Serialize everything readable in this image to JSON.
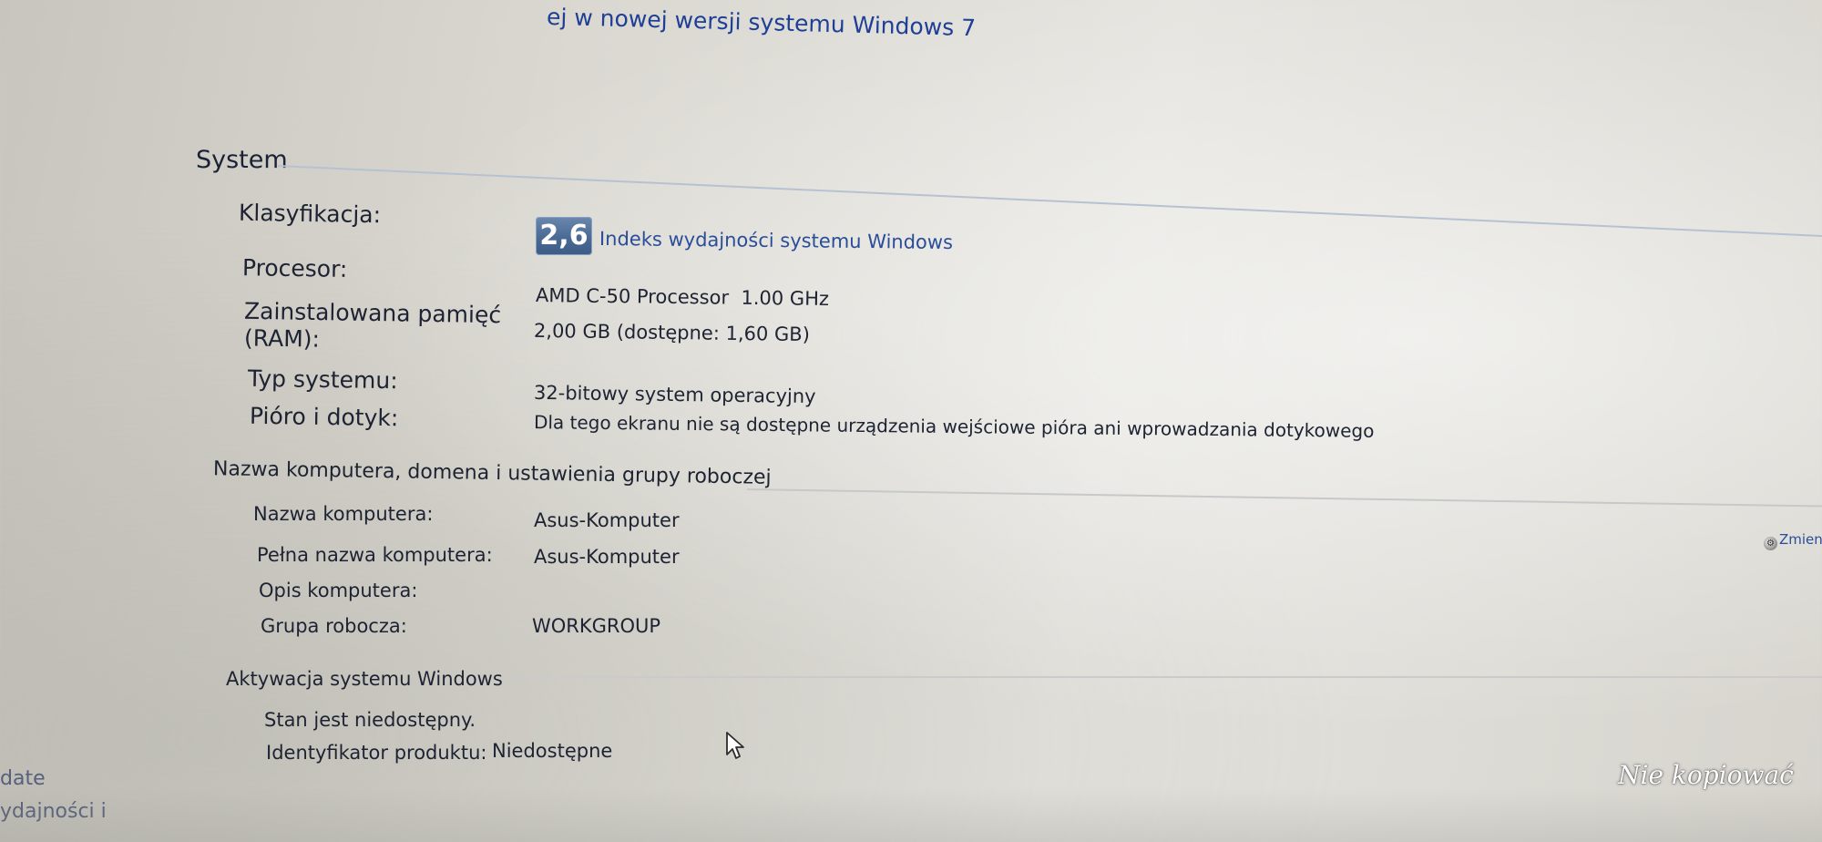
{
  "top_link": "ej w nowej wersji systemu Windows 7",
  "system": {
    "title": "System",
    "rating_label": "Klasyfikacja:",
    "rating_score": "2,6",
    "rating_link": "Indeks wydajności systemu Windows",
    "processor_label": "Procesor:",
    "processor_value": "AMD C-50 Processor  1.00 GHz",
    "ram_label_line1": "Zainstalowana pamięć",
    "ram_label_line2": "(RAM):",
    "ram_value": "2,00 GB (dostępne: 1,60 GB)",
    "type_label": "Typ systemu:",
    "type_value": "32-bitowy system operacyjny",
    "pen_label": "Pióro i dotyk:",
    "pen_value": "Dla tego ekranu nie są dostępne urządzenia wejściowe pióra ani wprowadzania dotykowego"
  },
  "computer": {
    "title": "Nazwa komputera, domena i ustawienia grupy roboczej",
    "name_label": "Nazwa komputera:",
    "name_value": "Asus-Komputer",
    "full_name_label": "Pełna nazwa komputera:",
    "full_name_value": "Asus-Komputer",
    "description_label": "Opis komputera:",
    "workgroup_label": "Grupa robocza:",
    "workgroup_value": "WORKGROUP",
    "change_link": "Zmien"
  },
  "activation": {
    "title": "Aktywacja systemu Windows",
    "status": "Stan jest niedostępny.",
    "product_id_label": "Identyfikator produktu:",
    "product_id_value": "Niedostępne"
  },
  "sidebar_partial": {
    "item1": "date",
    "item2": "ydajności i"
  },
  "watermark": "Nie kopiować",
  "icons": {
    "change": "shield-icon",
    "cursor": "mouse-pointer-icon"
  },
  "colors": {
    "link": "#2a4d9a",
    "wei_badge": "#4a6a94",
    "watermark": "#ffffff"
  }
}
